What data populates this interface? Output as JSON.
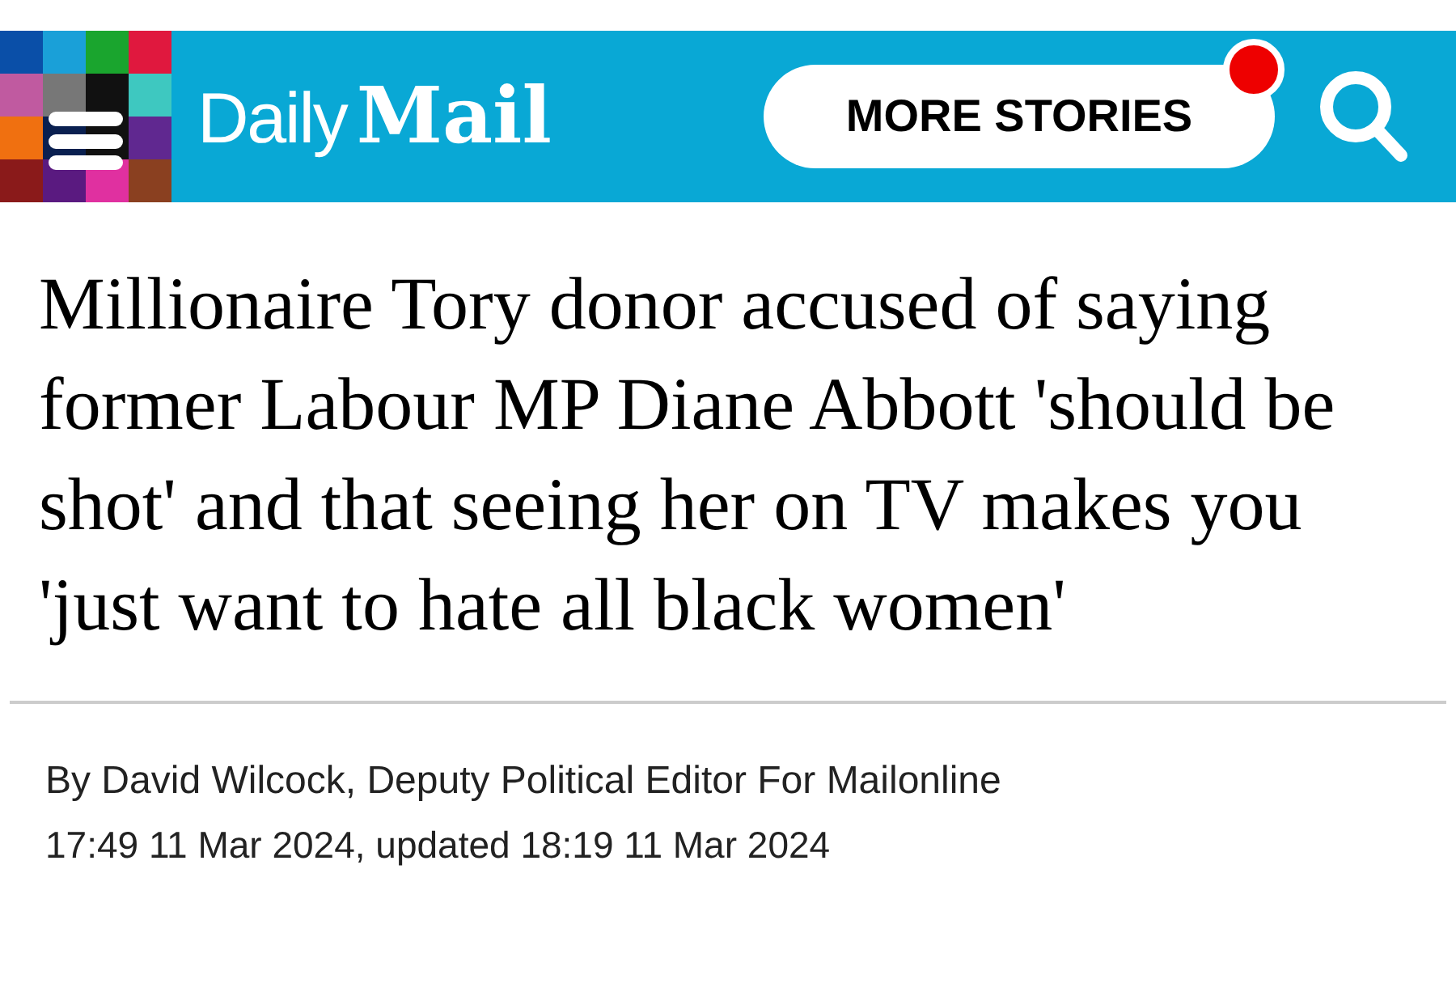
{
  "header": {
    "logo": {
      "light": "Daily",
      "bold": "Mail"
    },
    "more_stories": {
      "label": "MORE STORIES",
      "has_notification": true
    }
  },
  "article": {
    "headline": "Millionaire Tory donor accused of saying former Labour MP Diane Abbott 'should be shot' and that seeing her on TV makes you 'just want to hate all black women'",
    "byline": "By David Wilcock, Deputy Political Editor For Mailonline",
    "timestamp": "17:49 11 Mar 2024, updated 18:19 11 Mar 2024"
  }
}
